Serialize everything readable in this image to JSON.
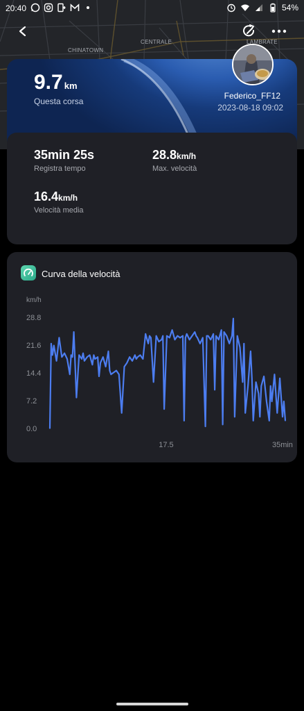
{
  "status_bar": {
    "time": "20:40",
    "battery": "54%"
  },
  "map": {
    "labels": [
      "CHINATOWN",
      "CENTRALE",
      "LAMBRATE"
    ]
  },
  "header": {
    "back_icon": "back-arrow-icon",
    "share_icon": "share-icon",
    "more_icon": "more-dots-icon"
  },
  "summary": {
    "distance_value": "9.7",
    "distance_unit": "km",
    "distance_label": "Questa corsa",
    "username": "Federico_FF12",
    "datetime": "2023-08-18 09:02"
  },
  "stats": {
    "time_value": "35min 25s",
    "time_label": "Registra tempo",
    "max_speed_value": "28.8",
    "max_speed_unit": "km/h",
    "max_speed_label": "Max. velocità",
    "avg_speed_value": "16.4",
    "avg_speed_unit": "km/h",
    "avg_speed_label": "Velocità media"
  },
  "chart_data": {
    "type": "line",
    "title": "Curva della velocità",
    "ylabel": "km/h",
    "yticks": [
      "28.8",
      "21.6",
      "14.4",
      "7.2",
      "0.0"
    ],
    "xticks": [
      "17.5",
      "35min"
    ],
    "ylim": [
      0,
      28.8
    ],
    "xlim": [
      0,
      35.42
    ],
    "color": "#4c7df0",
    "x": [
      0.0,
      0.2,
      0.4,
      0.6,
      1.0,
      1.4,
      1.8,
      2.2,
      2.6,
      3.0,
      3.2,
      3.4,
      3.6,
      4.0,
      4.4,
      4.8,
      5.0,
      5.2,
      5.6,
      6.0,
      6.4,
      6.6,
      6.8,
      7.2,
      7.4,
      7.6,
      8.0,
      8.4,
      8.8,
      9.0,
      9.2,
      9.6,
      10.0,
      10.4,
      10.8,
      11.2,
      11.6,
      12.0,
      12.4,
      12.8,
      13.0,
      13.2,
      13.6,
      14.0,
      14.4,
      14.8,
      15.0,
      15.2,
      15.6,
      16.0,
      16.4,
      16.8,
      17.0,
      17.2,
      17.6,
      18.0,
      18.4,
      18.8,
      19.2,
      19.6,
      20.0,
      20.2,
      20.4,
      20.6,
      21.0,
      21.4,
      21.8,
      22.0,
      22.2,
      22.6,
      23.0,
      23.4,
      23.6,
      23.8,
      24.2,
      24.6,
      24.8,
      25.0,
      25.4,
      25.8,
      26.0,
      26.2,
      26.6,
      27.0,
      27.4,
      27.6,
      27.8,
      28.2,
      28.6,
      29.0,
      29.2,
      29.4,
      29.8,
      30.2,
      30.4,
      30.6,
      31.0,
      31.4,
      31.6,
      31.8,
      32.2,
      32.6,
      33.0,
      33.2,
      33.4,
      33.8,
      34.2,
      34.6,
      35.0,
      35.2,
      35.42
    ],
    "y": [
      0.0,
      22.0,
      19.0,
      21.5,
      17.5,
      23.5,
      18.5,
      19.5,
      18.0,
      14.0,
      19.0,
      18.5,
      25.0,
      8.0,
      19.0,
      18.0,
      19.5,
      17.5,
      18.5,
      19.0,
      16.5,
      19.0,
      18.0,
      18.5,
      13.5,
      17.0,
      18.5,
      16.0,
      20.0,
      15.0,
      14.0,
      14.5,
      15.0,
      14.0,
      4.0,
      16.0,
      17.0,
      18.5,
      17.5,
      19.0,
      18.0,
      18.5,
      19.0,
      18.0,
      24.5,
      22.0,
      24.0,
      23.5,
      12.0,
      24.0,
      22.5,
      23.0,
      24.0,
      5.0,
      24.0,
      23.5,
      25.5,
      23.0,
      24.0,
      23.5,
      24.0,
      2.0,
      23.5,
      24.5,
      23.0,
      24.0,
      25.0,
      24.0,
      23.5,
      22.0,
      23.5,
      0.5,
      24.0,
      24.0,
      23.0,
      24.5,
      10.0,
      24.0,
      23.0,
      25.5,
      1.0,
      25.0,
      24.0,
      22.0,
      24.0,
      28.5,
      3.0,
      24.0,
      21.0,
      12.0,
      22.0,
      4.0,
      11.0,
      20.0,
      13.0,
      2.0,
      12.0,
      9.0,
      3.0,
      11.0,
      13.5,
      7.0,
      2.0,
      11.0,
      7.0,
      14.0,
      4.0,
      13.0,
      3.0,
      7.0,
      2.0
    ]
  }
}
